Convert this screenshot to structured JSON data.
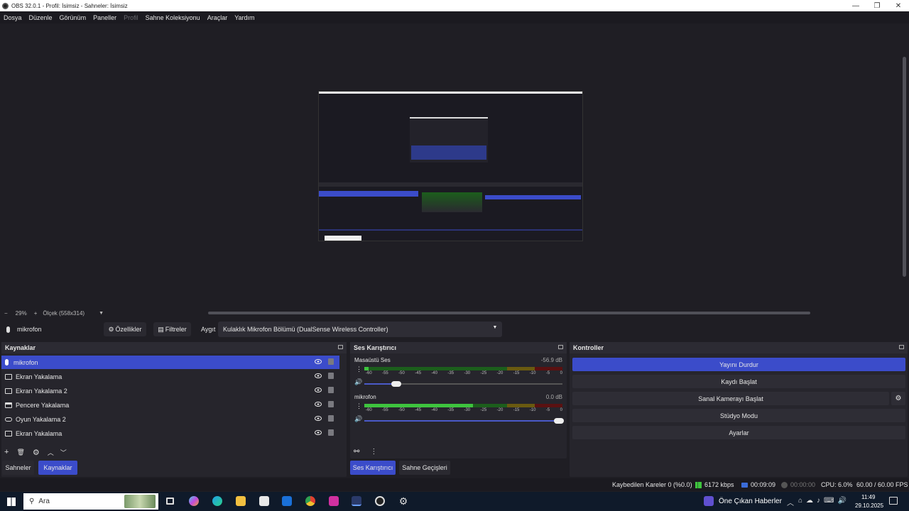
{
  "window": {
    "title": "OBS 32.0.1 - Profil: İsimsiz - Sahneler: İsimsiz",
    "minimize": "—",
    "maximize": "❐",
    "close": "✕"
  },
  "menu": [
    "Dosya",
    "Düzenle",
    "Görünüm",
    "Paneller",
    "Profil",
    "Sahne Koleksiyonu",
    "Araçlar",
    "Yardım"
  ],
  "zoom": {
    "minus": "−",
    "value": "29%",
    "plus": "+",
    "scale_label": "Ölçek (558x314)"
  },
  "source_bar": {
    "selected_source": "mikrofon",
    "properties": "Özellikler",
    "filters": "Filtreler",
    "device_label": "Aygıt",
    "device_value": "Kulaklık Mikrofon Bölümü (DualSense Wireless Controller)"
  },
  "sources": {
    "title": "Kaynaklar",
    "items": [
      {
        "label": "mikrofon",
        "icon": "mic-icon",
        "selected": true
      },
      {
        "label": "Ekran Yakalama",
        "icon": "monitor-icon"
      },
      {
        "label": "Ekran Yakalama 2",
        "icon": "monitor-icon"
      },
      {
        "label": "Pencere Yakalama",
        "icon": "window-icon"
      },
      {
        "label": "Oyun Yakalama 2",
        "icon": "gamepad-icon"
      },
      {
        "label": "Ekran Yakalama",
        "icon": "monitor-icon"
      }
    ]
  },
  "mixer": {
    "title": "Ses Karıştırıcı",
    "ticks": [
      "-60",
      "-55",
      "-50",
      "-45",
      "-40",
      "-35",
      "-30",
      "-25",
      "-20",
      "-15",
      "-10",
      "-5",
      "0"
    ],
    "channels": [
      {
        "name": "Masaüstü Ses",
        "db": "-56.9 dB",
        "level": 0.02,
        "volume": 0.18
      },
      {
        "name": "mikrofon",
        "db": "0.0 dB",
        "level": 0.55,
        "volume": 1.0
      }
    ]
  },
  "controls": {
    "title": "Kontroller",
    "buttons": [
      "Yayını Durdur",
      "Kaydı Başlat",
      "Sanal Kamerayı Başlat",
      "Stüdyo Modu",
      "Ayarlar"
    ]
  },
  "tabs": {
    "scenes": "Sahneler",
    "sources": "Kaynaklar",
    "mixer": "Ses Karıştırıcı",
    "transitions": "Sahne Geçişleri"
  },
  "status": {
    "dropped": "Kaybedilen Kareler 0 (%0.0)",
    "bitrate": "6172 kbps",
    "stream_time": "00:09:09",
    "rec_time": "00:00:00",
    "cpu": "CPU: 6.0%",
    "fps": "60.00 / 60.00 FPS"
  },
  "taskbar": {
    "search_placeholder": "Ara",
    "news": "Öne Çıkan Haberler",
    "time": "11:49",
    "date": "29.10.2025"
  },
  "colors": {
    "accent": "#3b4cca",
    "bg": "#1f1e24",
    "panel": "#26252c"
  }
}
